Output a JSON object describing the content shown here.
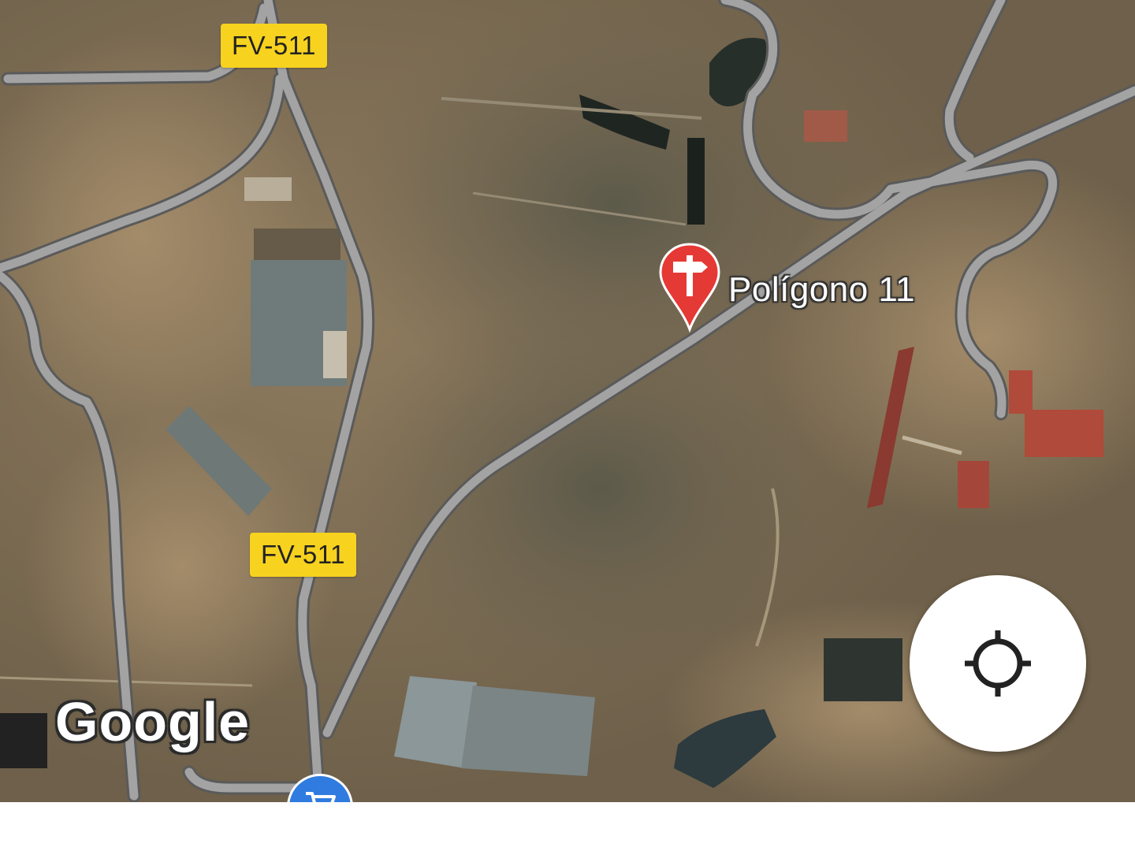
{
  "map": {
    "type": "satellite",
    "road_labels": [
      "FV-511",
      "FV-511"
    ],
    "place_label": "Polígono 11",
    "attribution": "Google",
    "colors": {
      "terrain": "#7a6a52",
      "road": "#9a9a9a",
      "badge": "#f7d21e",
      "pin": "#e53935",
      "locate_button": "#ffffff",
      "nav_button": "#2f7be0"
    }
  },
  "controls": {
    "locate_icon": "crosshair-icon",
    "nav_icon": "cart-icon",
    "pin_icon": "signpost-pin-icon"
  }
}
